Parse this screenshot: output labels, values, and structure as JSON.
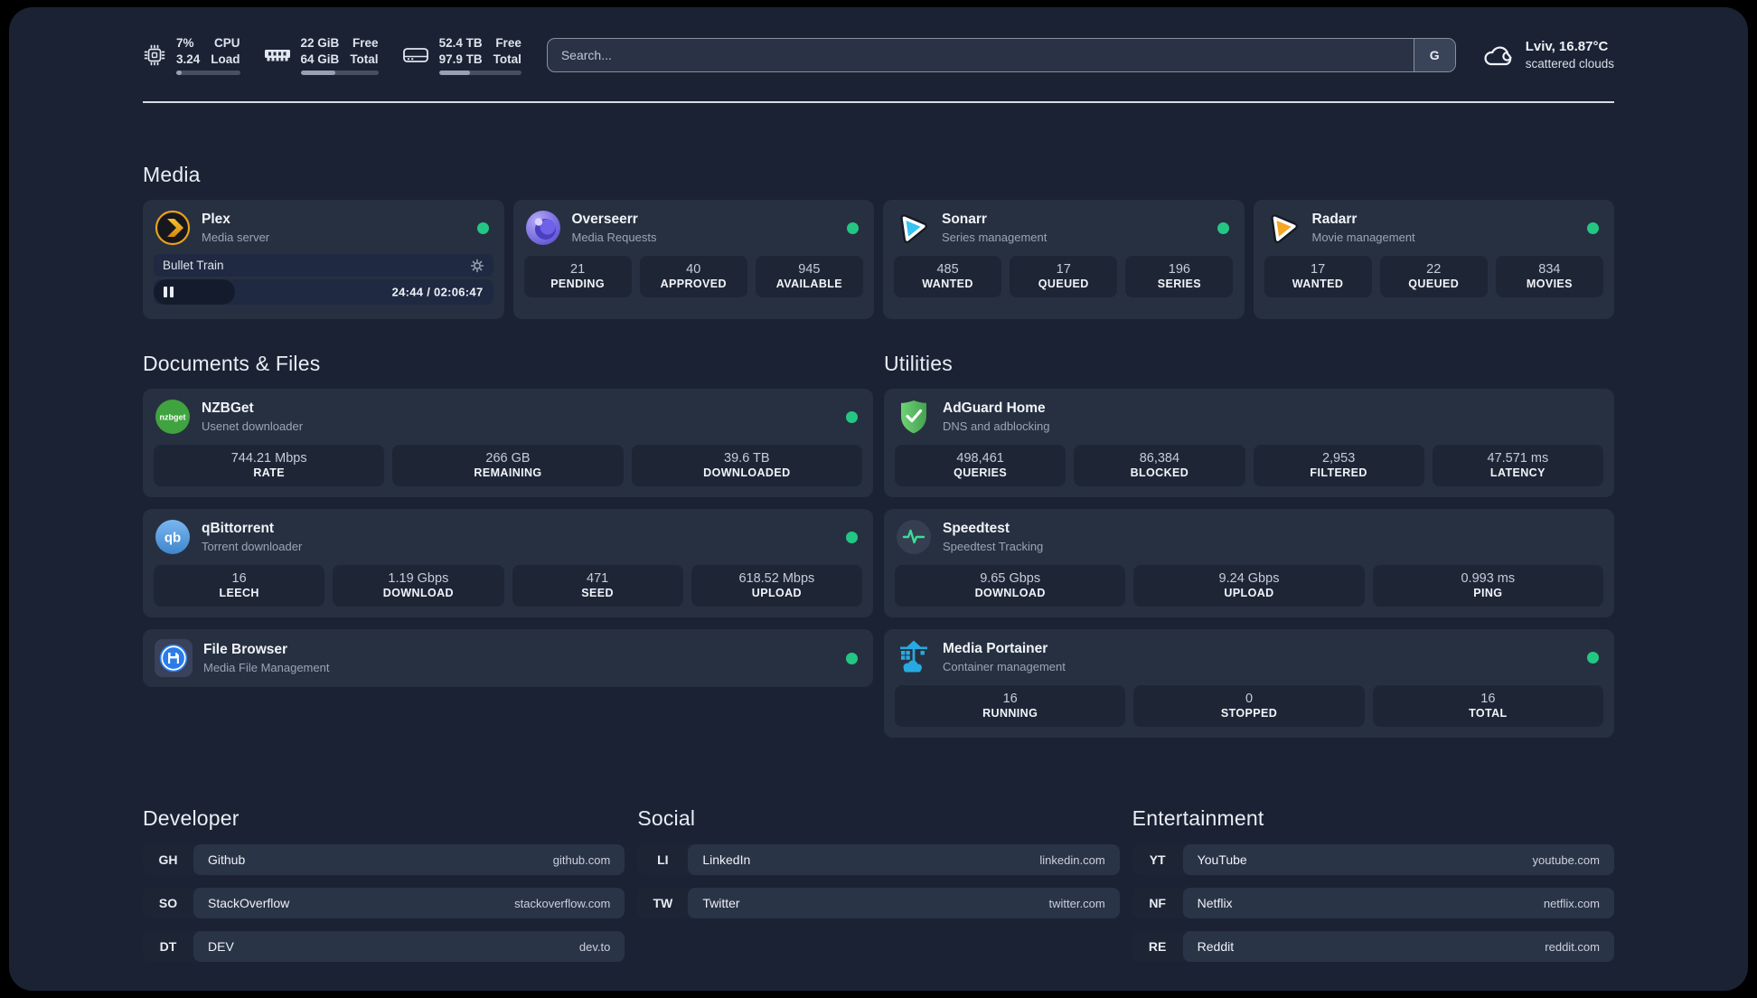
{
  "system": {
    "cpu": {
      "value_top": "7%",
      "value_bottom": "3.24",
      "label_top": "CPU",
      "label_bottom": "Load",
      "progress_pct": 8
    },
    "memory": {
      "value_top": "22 GiB",
      "value_bottom": "64 GiB",
      "label_top": "Free",
      "label_bottom": "Total",
      "progress_pct": 45
    },
    "disk": {
      "value_top": "52.4 TB",
      "value_bottom": "97.9 TB",
      "label_top": "Free",
      "label_bottom": "Total",
      "progress_pct": 38
    }
  },
  "search": {
    "placeholder": "Search...",
    "engine_button": "G"
  },
  "weather": {
    "location_temp": "Lviv, 16.87°C",
    "description": "scattered clouds"
  },
  "colors": {
    "status_online": "#23c783",
    "plex_gold": "#e9a11c",
    "overseerr_purple": "#5d4fd3",
    "sonarr_cyan": "#36c3f1",
    "radarr_amber": "#f5a623",
    "nzbget_green": "#3fa33f",
    "qbittorrent_blue": "#3f86cc",
    "adguard_green": "#5cc465",
    "speedtest_green": "#3ddc97",
    "portainer_blue": "#29a9e1",
    "filebrowser_blue": "#2a7ce8"
  },
  "sections": {
    "media": {
      "title": "Media",
      "apps": [
        {
          "name": "Plex",
          "subtitle": "Media server",
          "status": "online",
          "player": {
            "title": "Bullet Train",
            "time": "24:44 / 02:06:47",
            "progress_pct": 24
          }
        },
        {
          "name": "Overseerr",
          "subtitle": "Media Requests",
          "status": "online",
          "stats": [
            {
              "value": "21",
              "label": "PENDING"
            },
            {
              "value": "40",
              "label": "APPROVED"
            },
            {
              "value": "945",
              "label": "AVAILABLE"
            }
          ]
        },
        {
          "name": "Sonarr",
          "subtitle": "Series management",
          "status": "online",
          "stats": [
            {
              "value": "485",
              "label": "WANTED"
            },
            {
              "value": "17",
              "label": "QUEUED"
            },
            {
              "value": "196",
              "label": "SERIES"
            }
          ]
        },
        {
          "name": "Radarr",
          "subtitle": "Movie management",
          "status": "online",
          "stats": [
            {
              "value": "17",
              "label": "WANTED"
            },
            {
              "value": "22",
              "label": "QUEUED"
            },
            {
              "value": "834",
              "label": "MOVIES"
            }
          ]
        }
      ]
    },
    "documents": {
      "title": "Documents & Files",
      "apps": [
        {
          "name": "NZBGet",
          "subtitle": "Usenet downloader",
          "status": "online",
          "stats": [
            {
              "value": "744.21 Mbps",
              "label": "RATE"
            },
            {
              "value": "266 GB",
              "label": "REMAINING"
            },
            {
              "value": "39.6 TB",
              "label": "DOWNLOADED"
            }
          ]
        },
        {
          "name": "qBittorrent",
          "subtitle": "Torrent downloader",
          "status": "online",
          "stats": [
            {
              "value": "16",
              "label": "LEECH"
            },
            {
              "value": "1.19 Gbps",
              "label": "DOWNLOAD"
            },
            {
              "value": "471",
              "label": "SEED"
            },
            {
              "value": "618.52 Mbps",
              "label": "UPLOAD"
            }
          ]
        },
        {
          "name": "File Browser",
          "subtitle": "Media File Management",
          "status": "online"
        }
      ]
    },
    "utilities": {
      "title": "Utilities",
      "apps": [
        {
          "name": "AdGuard Home",
          "subtitle": "DNS and adblocking",
          "stats": [
            {
              "value": "498,461",
              "label": "QUERIES"
            },
            {
              "value": "86,384",
              "label": "BLOCKED"
            },
            {
              "value": "2,953",
              "label": "FILTERED"
            },
            {
              "value": "47.571 ms",
              "label": "LATENCY"
            }
          ]
        },
        {
          "name": "Speedtest",
          "subtitle": "Speedtest Tracking",
          "stats": [
            {
              "value": "9.65 Gbps",
              "label": "DOWNLOAD"
            },
            {
              "value": "9.24 Gbps",
              "label": "UPLOAD"
            },
            {
              "value": "0.993 ms",
              "label": "PING"
            }
          ]
        },
        {
          "name": "Media Portainer",
          "subtitle": "Container management",
          "status": "online",
          "stats": [
            {
              "value": "16",
              "label": "RUNNING"
            },
            {
              "value": "0",
              "label": "STOPPED"
            },
            {
              "value": "16",
              "label": "TOTAL"
            }
          ]
        }
      ]
    },
    "developer": {
      "title": "Developer",
      "links": [
        {
          "abbr": "GH",
          "name": "Github",
          "url": "github.com"
        },
        {
          "abbr": "SO",
          "name": "StackOverflow",
          "url": "stackoverflow.com"
        },
        {
          "abbr": "DT",
          "name": "DEV",
          "url": "dev.to"
        }
      ]
    },
    "social": {
      "title": "Social",
      "links": [
        {
          "abbr": "LI",
          "name": "LinkedIn",
          "url": "linkedin.com"
        },
        {
          "abbr": "TW",
          "name": "Twitter",
          "url": "twitter.com"
        }
      ]
    },
    "entertainment": {
      "title": "Entertainment",
      "links": [
        {
          "abbr": "YT",
          "name": "YouTube",
          "url": "youtube.com"
        },
        {
          "abbr": "NF",
          "name": "Netflix",
          "url": "netflix.com"
        },
        {
          "abbr": "RE",
          "name": "Reddit",
          "url": "reddit.com"
        }
      ]
    }
  }
}
